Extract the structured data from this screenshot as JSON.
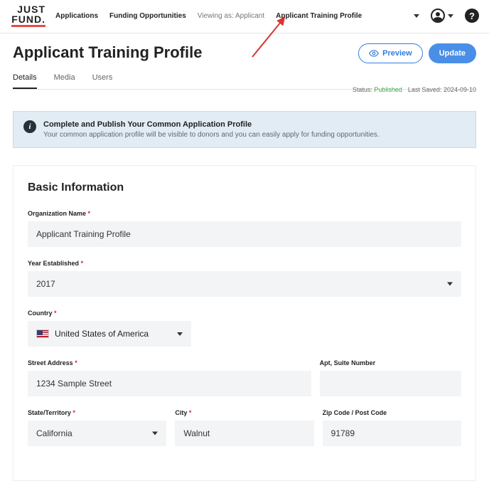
{
  "topbar": {
    "logo_top": "JUST",
    "logo_bottom": "FUND.",
    "nav": {
      "applications": "Applications",
      "funding": "Funding Opportunities",
      "viewing_as": "Viewing as: Applicant",
      "profile": "Applicant Training Profile"
    }
  },
  "header": {
    "title": "Applicant Training Profile",
    "preview": "Preview",
    "update": "Update"
  },
  "tabs": {
    "details": "Details",
    "media": "Media",
    "users": "Users"
  },
  "status": {
    "label": "Status:",
    "value": "Published",
    "saved_label": "Last Saved:",
    "saved_value": "2024-09-10"
  },
  "notice": {
    "title": "Complete and Publish Your Common Application Profile",
    "body": "Your common application profile will be visible to donors and you can easily apply for funding opportunities."
  },
  "form": {
    "section_title": "Basic Information",
    "org_name_label": "Organization Name",
    "org_name_value": "Applicant Training Profile",
    "year_label": "Year Established",
    "year_value": "2017",
    "country_label": "Country",
    "country_value": "United States of America",
    "street_label": "Street Address",
    "street_value": "1234 Sample Street",
    "apt_label": "Apt, Suite Number",
    "apt_value": "",
    "state_label": "State/Territory",
    "state_value": "California",
    "city_label": "City",
    "city_value": "Walnut",
    "zip_label": "Zip Code / Post Code",
    "zip_value": "91789"
  }
}
